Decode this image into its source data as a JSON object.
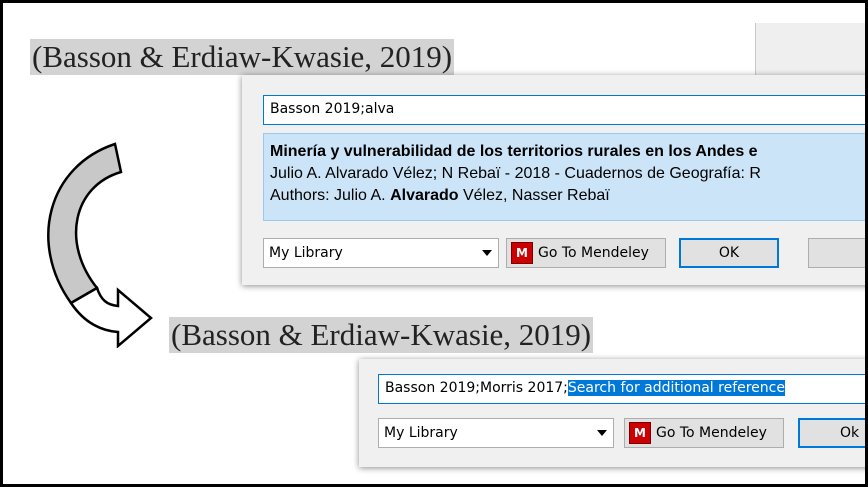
{
  "citation_top": "(Basson & Erdiaw-Kwasie, 2019)",
  "citation_bottom": "(Basson & Erdiaw-Kwasie, 2019)",
  "dialog1": {
    "search_value": "Basson 2019;alva",
    "result": {
      "title": "Minería y vulnerabilidad de los territorios rurales en los Andes e",
      "meta": "Julio A. Alvarado Vélez; N Rebaï - 2018 - Cuadernos de Geografía: R",
      "authors_prefix": "Authors: Julio A. ",
      "authors_bold": "Alvarado",
      "authors_suffix": " Vélez, Nasser Rebaï"
    },
    "library": "My Library",
    "goto_label": "Go To Mendeley",
    "ok_label": "OK"
  },
  "dialog2": {
    "search_value_plain": "Basson 2019;Morris 2017;",
    "search_value_selected": "Search for additional reference",
    "library": "My Library",
    "goto_label": "Go To Mendeley",
    "ok_label": "Ok"
  },
  "colors": {
    "selection": "#0078d7",
    "result_bg": "#cce4f7",
    "mendeley_red": "#c00000",
    "citation_highlight": "#d3d3d3"
  },
  "icons": [
    "mendeley-logo-icon",
    "dropdown-caret-icon",
    "curved-arrow-icon"
  ]
}
